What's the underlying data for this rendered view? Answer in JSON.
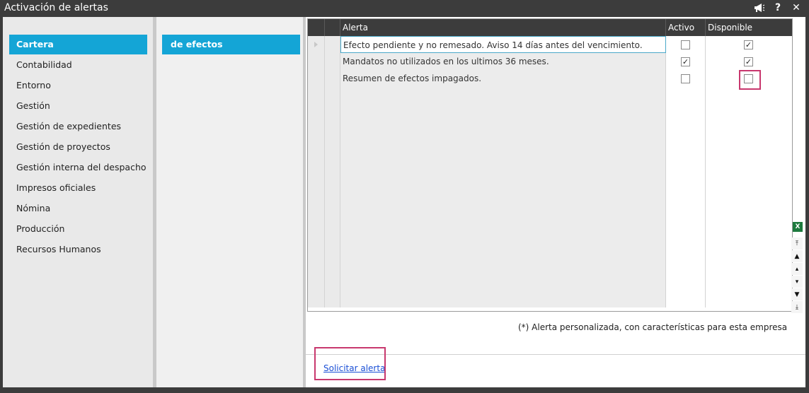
{
  "window": {
    "title": "Activación de alertas",
    "icons": [
      "megaphone-icon",
      "help-icon",
      "close-icon"
    ]
  },
  "categories": [
    {
      "label": "Cartera",
      "selected": true
    },
    {
      "label": "Contabilidad"
    },
    {
      "label": "Entorno"
    },
    {
      "label": "Gestión"
    },
    {
      "label": "Gestión de expedientes"
    },
    {
      "label": "Gestión de proyectos"
    },
    {
      "label": "Gestión interna del despacho"
    },
    {
      "label": "Impresos oficiales"
    },
    {
      "label": "Nómina"
    },
    {
      "label": "Producción"
    },
    {
      "label": "Recursos Humanos"
    }
  ],
  "subcategory": {
    "label": "de efectos",
    "selected": true
  },
  "grid": {
    "columns": {
      "alert": "Alerta",
      "active": "Activo",
      "available": "Disponible"
    },
    "rows": [
      {
        "alert": "Efecto pendiente y no remesado. Aviso 14 días antes del vencimiento.",
        "active": false,
        "available": true
      },
      {
        "alert": "Mandatos no utilizados en los ultimos 36 meses.",
        "active": true,
        "available": true
      },
      {
        "alert": "Resumen de efectos impagados.",
        "active": false,
        "available": false
      }
    ],
    "empty_rows": 13
  },
  "footnote": "(*) Alerta personalizada, con características para esta empresa",
  "request_link": "Solicitar alerta",
  "colors": {
    "accent": "#14a5d6",
    "titlebar": "#3c3c3c",
    "highlight": "#c8386e"
  }
}
